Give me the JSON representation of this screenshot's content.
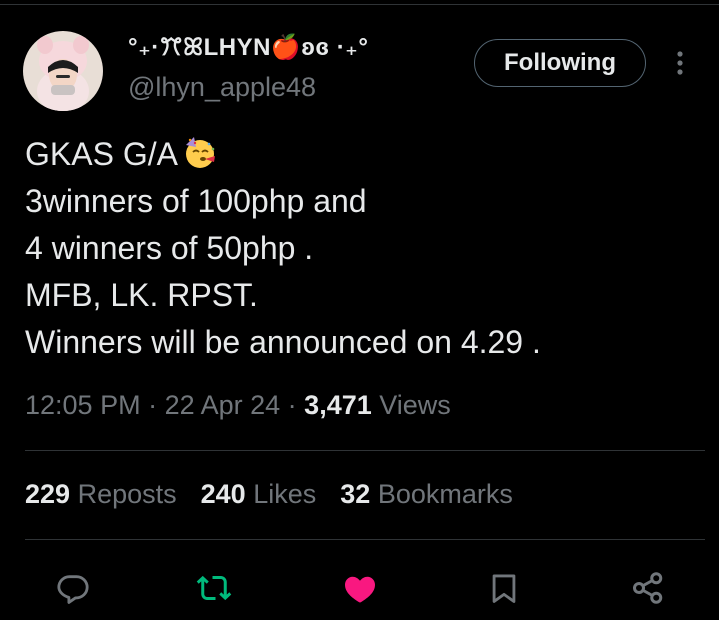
{
  "author": {
    "display_name": "°₊·ꔫꕤLHYN🍎ʚɞ ·₊°",
    "handle": "@lhyn_apple48",
    "avatar": "avatar-photo"
  },
  "follow_button": {
    "label": "Following"
  },
  "more_icon": "more-vertical-icon",
  "tweet": {
    "lines": [
      "GKAS G/A",
      "3winners of 100php and",
      "4 winners of 50php .",
      "MFB, LK. RPST.",
      "Winners will be announced on 4.29 ."
    ],
    "emoji": "partying-face-emoji"
  },
  "meta": {
    "time": "12:05 PM",
    "sep1": " · ",
    "date": "22 Apr 24",
    "sep2": " · ",
    "views_count": "3,471",
    "views_label": " Views"
  },
  "stats": {
    "reposts_count": "229",
    "reposts_label": "Reposts",
    "likes_count": "240",
    "likes_label": "Likes",
    "bookmarks_count": "32",
    "bookmarks_label": "Bookmarks"
  },
  "actions": {
    "reply_icon": "reply-icon",
    "repost_icon": "repost-icon",
    "like_icon": "like-icon",
    "bookmark_icon": "bookmark-icon",
    "share_icon": "share-icon"
  },
  "colors": {
    "background": "#000000",
    "text": "#e7e9ea",
    "secondary_text": "#71767b",
    "repost_active": "#00ba7c",
    "like_active": "#f91880",
    "divider": "#2f3336"
  }
}
